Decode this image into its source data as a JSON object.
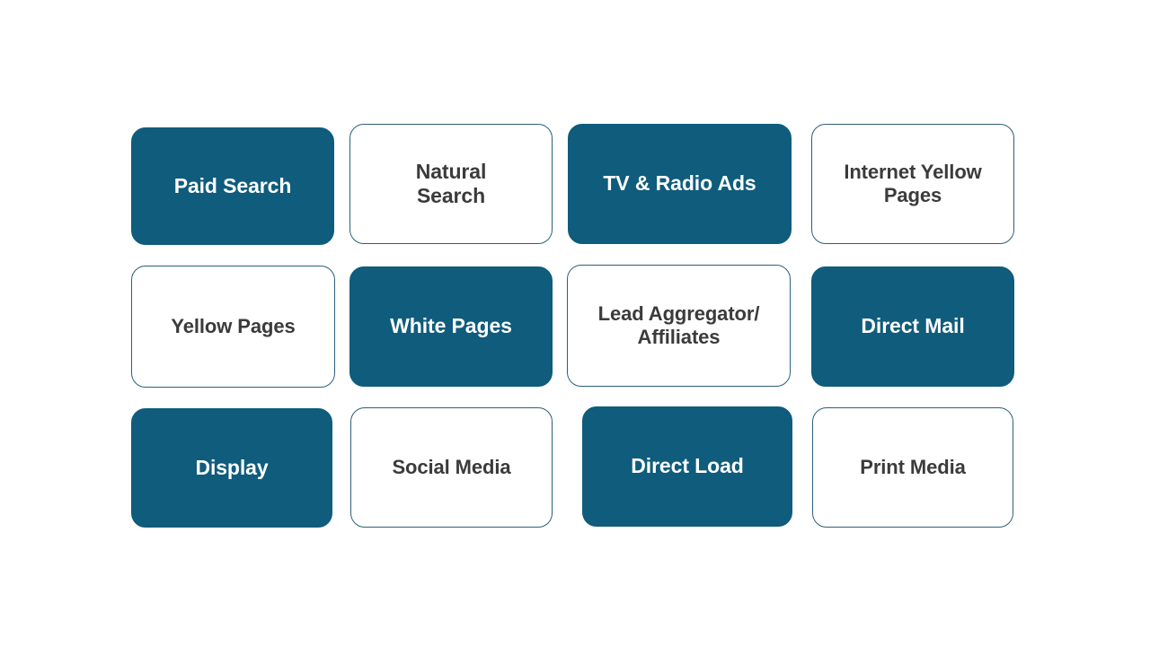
{
  "slide": {
    "background_color": "#ffffff",
    "accent_color": "#0f5c7c",
    "outline_border_color": "#2b6078",
    "dark_text_color": "#3b3b3b",
    "light_text_color": "#ffffff"
  },
  "grid": {
    "columns": 4,
    "rows": 3,
    "tiles": [
      {
        "label": "Paid Search",
        "style": "filled",
        "row": 1,
        "col": 1
      },
      {
        "label": "Natural\nSearch",
        "style": "outline",
        "row": 1,
        "col": 2
      },
      {
        "label": "TV & Radio Ads",
        "style": "filled",
        "row": 1,
        "col": 3
      },
      {
        "label": "Internet Yellow\nPages",
        "style": "outline",
        "row": 1,
        "col": 4
      },
      {
        "label": "Yellow Pages",
        "style": "outline",
        "row": 2,
        "col": 1
      },
      {
        "label": "White Pages",
        "style": "filled",
        "row": 2,
        "col": 2
      },
      {
        "label": "Lead Aggregator/\nAffiliates",
        "style": "outline",
        "row": 2,
        "col": 3
      },
      {
        "label": "Direct Mail",
        "style": "filled",
        "row": 2,
        "col": 4
      },
      {
        "label": "Display",
        "style": "filled",
        "row": 3,
        "col": 1
      },
      {
        "label": "Social Media",
        "style": "outline",
        "row": 3,
        "col": 2
      },
      {
        "label": "Direct Load",
        "style": "filled",
        "row": 3,
        "col": 3
      },
      {
        "label": "Print Media",
        "style": "outline",
        "row": 3,
        "col": 4
      }
    ]
  }
}
